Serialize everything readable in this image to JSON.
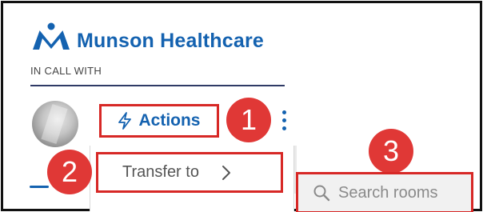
{
  "brand": {
    "name": "Munson Healthcare",
    "color": "#1462b0",
    "logo_icon": "munson-logo"
  },
  "call": {
    "status_label": "IN CALL WITH"
  },
  "actions": {
    "label": "Actions",
    "icon": "lightning-bolt-icon"
  },
  "menu": {
    "transfer_label": "Transfer to",
    "chevron_icon": "chevron-right-icon"
  },
  "search": {
    "placeholder": "Search rooms",
    "value": ""
  },
  "steps": [
    "1",
    "2",
    "3"
  ],
  "colors": {
    "highlight": "#d72826",
    "badge": "#e03836",
    "text_primary": "#1462b0"
  }
}
